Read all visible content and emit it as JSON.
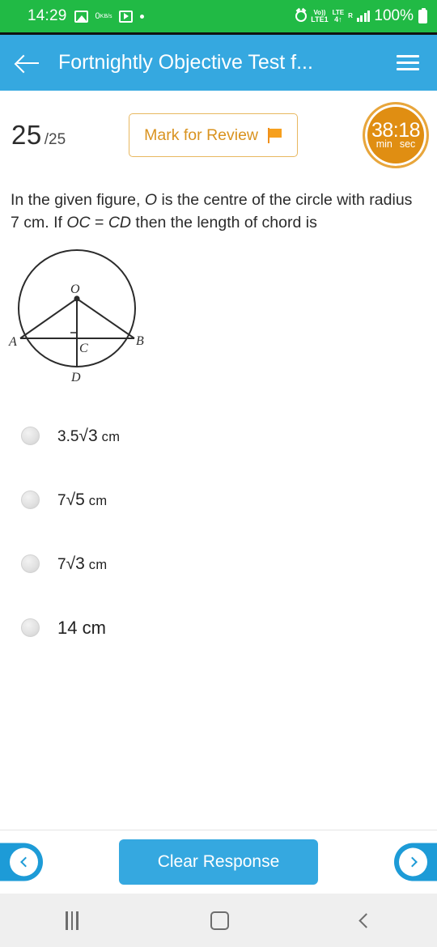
{
  "status_bar": {
    "time": "14:29",
    "icons": [
      "photo-icon",
      "network-speed-icon",
      "video-icon",
      "dot-icon"
    ],
    "network_speed_value": "0",
    "network_speed_unit": "KB/s",
    "alarm_icon": "alarm-icon",
    "volte_line1": "Vo))",
    "volte_line2": "LTE1",
    "lte_line1": "LTE",
    "lte_line2": "4↑",
    "roaming": "R",
    "battery_text": "100%",
    "background_color": "#21ba45"
  },
  "app_bar": {
    "back_label": "back-arrow",
    "title": "Fortnightly Objective Test f...",
    "menu_label": "menu",
    "background_color": "#35a8e0"
  },
  "question_header": {
    "current_number": "25",
    "total_number": "/25",
    "mark_for_review_label": "Mark for Review",
    "flag_icon": "flag-icon",
    "accent_color": "#d99320",
    "timer": {
      "value": "38:18",
      "unit_minutes": "min",
      "unit_seconds": "sec",
      "color": "#e08e12"
    }
  },
  "question": {
    "text_part1": "In the given figure, ",
    "italic1": "O",
    "text_part2": " is the centre of the circle with radius 7 cm. If ",
    "italic2": "OC",
    "text_part3": " = ",
    "italic3": "CD",
    "text_part4": " then the length of chord is",
    "figure": {
      "name": "circle-chord-diagram",
      "labels": [
        "O",
        "A",
        "B",
        "C",
        "D"
      ],
      "description": "Circle with centre O, horizontal chord AB, perpendicular OC meeting AB at C and extended to D on the circle, with right angle mark at C"
    }
  },
  "options": [
    {
      "id": "option-1",
      "coefficient": "3.5",
      "radical": "√3",
      "unit": "cm",
      "display": "3.5√3 cm",
      "style": "math",
      "selected": false
    },
    {
      "id": "option-2",
      "coefficient": "7",
      "radical": "√5",
      "unit": "cm",
      "display": "7√5 cm",
      "style": "math",
      "selected": false
    },
    {
      "id": "option-3",
      "coefficient": "7",
      "radical": "√3",
      "unit": "cm",
      "display": "7√3 cm",
      "style": "math",
      "selected": false
    },
    {
      "id": "option-4",
      "coefficient": "",
      "radical": "",
      "unit": "",
      "display": "14 cm",
      "style": "plain",
      "selected": false
    }
  ],
  "action_bar": {
    "prev_label": "previous-question",
    "next_label": "next-question",
    "clear_label": "Clear Response",
    "button_color": "#35a8e0",
    "nav_color": "#1d9bd7"
  },
  "system_nav": {
    "recent_label": "recent-apps",
    "home_label": "home",
    "back_label": "back"
  }
}
